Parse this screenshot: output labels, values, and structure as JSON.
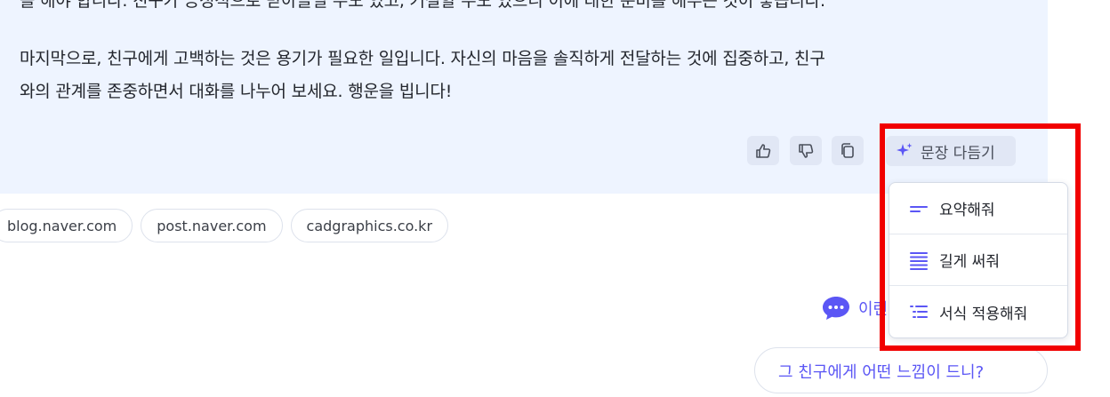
{
  "answer": {
    "paragraph_cut": "을 해야 합니다. 친구가 긍정적으로 받아들일 수도 있고, 거절할 수도 있으니 이에 대한 준비를 해두는 것이 좋습니다.",
    "paragraph_last_line1": "마지막으로, 친구에게 고백하는 것은 용기가 필요한 일입니다. 자신의 마음을 솔직하게 전달하는 것에 집중하고, 친구",
    "paragraph_last_line2": "와의 관계를 존중하면서 대화를 나누어 보세요. 행운을 빕니다!"
  },
  "actions": {
    "like_icon": "thumbs-up-icon",
    "dislike_icon": "thumbs-down-icon",
    "copy_icon": "copy-icon",
    "rewrite_icon": "sparkle-icon",
    "rewrite_label": "문장 다듬기"
  },
  "rewrite_menu": {
    "items": [
      {
        "label": "요약해줘",
        "icon": "short-lines-icon"
      },
      {
        "label": "길게 써줘",
        "icon": "long-lines-icon"
      },
      {
        "label": "서식 적용해줘",
        "icon": "list-format-icon"
      }
    ]
  },
  "sources": [
    "blog.naver.com",
    "post.naver.com",
    "cadgraphics.co.kr"
  ],
  "followup": {
    "icon": "chat-bubble-icon",
    "label_partial": "이런"
  },
  "suggestion": {
    "text": "그 친구에게 어떤 느낌이 드니?"
  },
  "colors": {
    "panel_bg": "#eef4ff",
    "accent": "#5b56f5",
    "highlight": "#f10000"
  }
}
